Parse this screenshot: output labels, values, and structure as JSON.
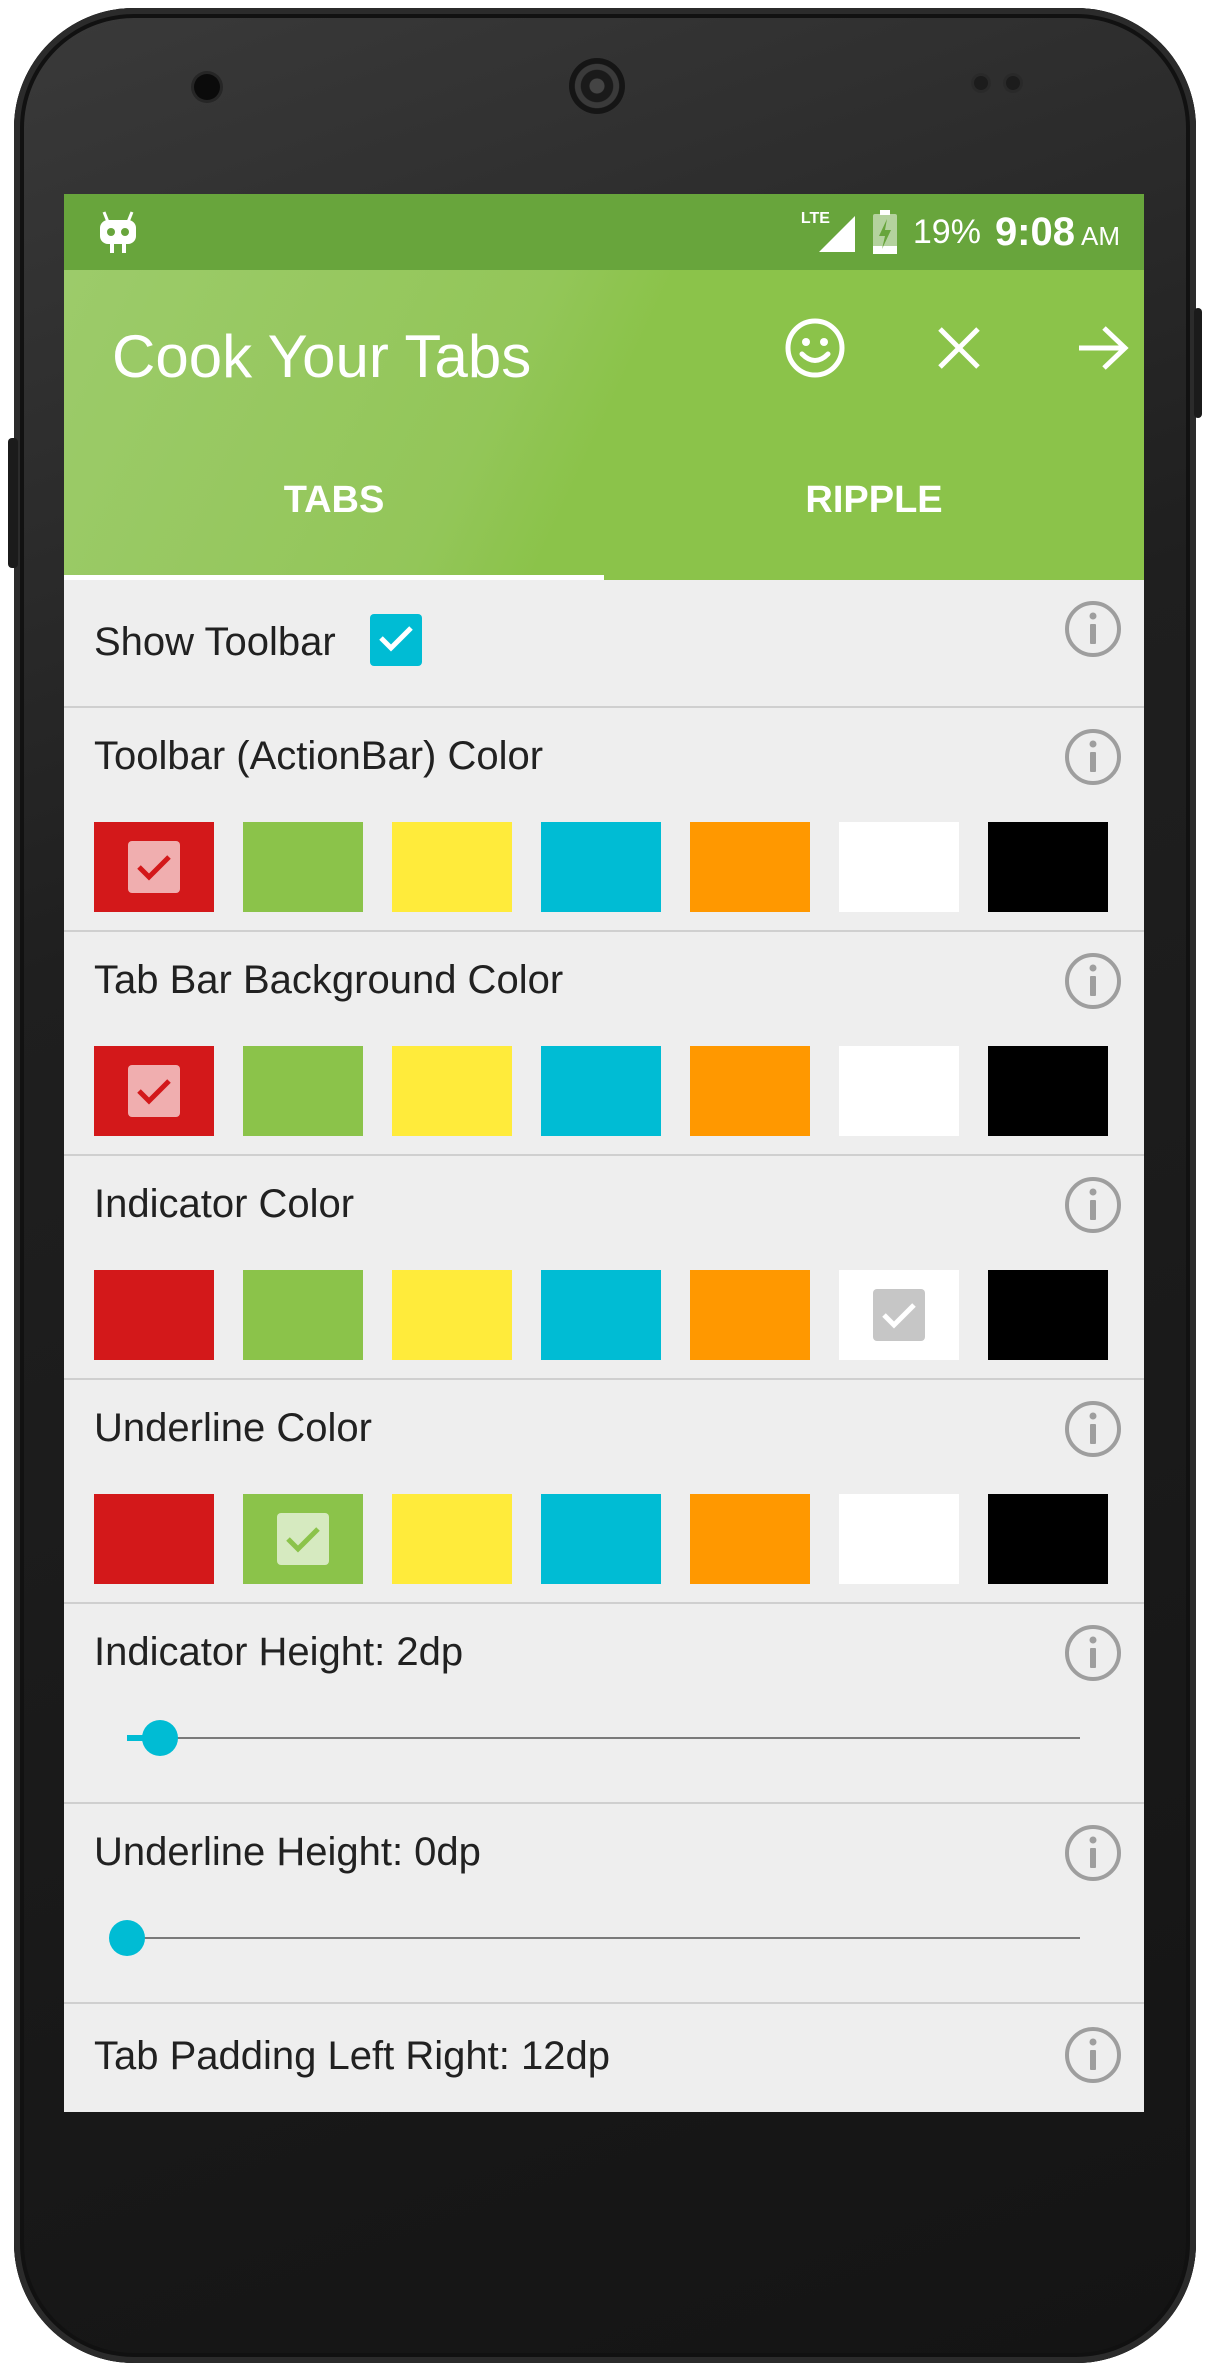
{
  "statusbar": {
    "network": "LTE",
    "battery": "19%",
    "time": "9:08",
    "ampm": "AM"
  },
  "app": {
    "title": "Cook Your Tabs",
    "accent": "#8bc34a",
    "check_color": "#00bcd4"
  },
  "actions": [
    "smiley-icon",
    "close-icon",
    "arrow-forward-icon"
  ],
  "tabs": [
    {
      "label": "TABS",
      "selected": true
    },
    {
      "label": "RIPPLE",
      "selected": false
    }
  ],
  "settings": {
    "show_toolbar": {
      "label": "Show Toolbar",
      "checked": true
    },
    "toolbar_color": {
      "label": "Toolbar (ActionBar) Color",
      "selected": 0
    },
    "tabbar_color": {
      "label": "Tab Bar Background Color",
      "selected": 0
    },
    "indicator_color": {
      "label": "Indicator Color",
      "selected": 5
    },
    "underline_color": {
      "label": "Underline Color",
      "selected": 1
    },
    "indicator_height": {
      "label": "Indicator Height: 2dp",
      "fraction": 0.035
    },
    "underline_height": {
      "label": "Underline Height: 0dp",
      "fraction": 0.0
    },
    "tab_padding": {
      "label": "Tab Padding Left Right: 12dp"
    }
  },
  "palette": [
    "#d3181a",
    "#8bc34a",
    "#ffeb3b",
    "#00bcd4",
    "#ff9800",
    "#ffffff",
    "#000000"
  ]
}
